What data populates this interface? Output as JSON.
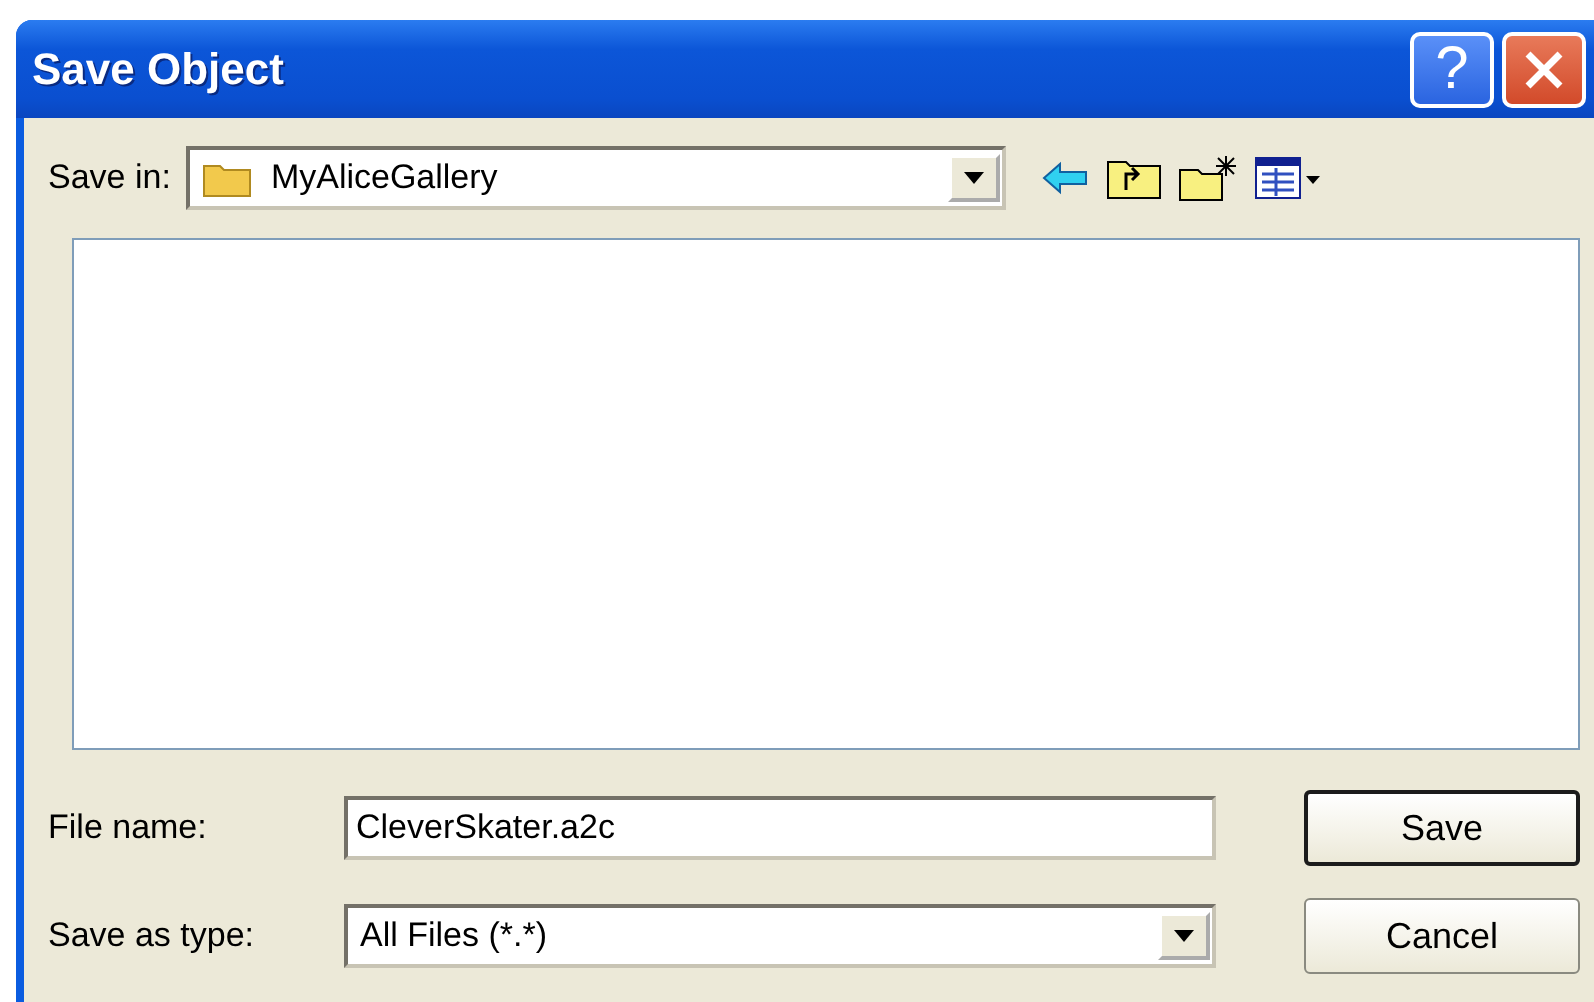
{
  "window": {
    "title": "Save Object",
    "help": "?"
  },
  "save_in": {
    "label": "Save in:",
    "value": "MyAliceGallery"
  },
  "file_name": {
    "label": "File name:",
    "value": "CleverSkater.a2c"
  },
  "save_as_type": {
    "label": "Save as type:",
    "value": "All Files (*.*)"
  },
  "buttons": [
    {
      "label": "Save",
      "default": true
    },
    {
      "label": "Cancel",
      "default": false
    }
  ]
}
